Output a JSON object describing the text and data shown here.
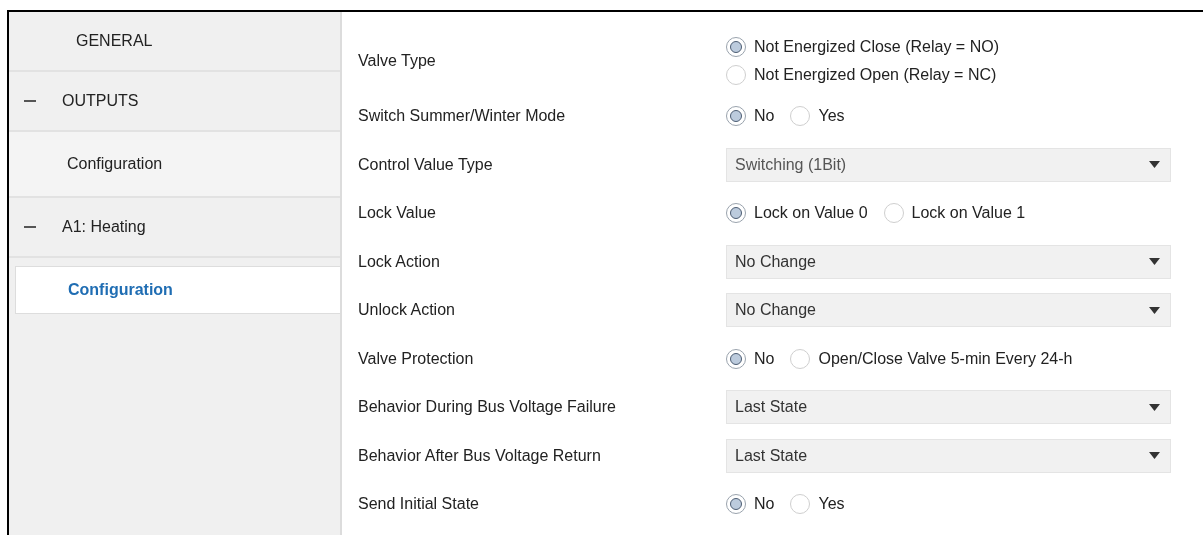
{
  "sidebar": {
    "items": [
      {
        "label": "GENERAL",
        "selected": false
      },
      {
        "label": "OUTPUTS",
        "expanded": true,
        "children": [
          {
            "label": "Configuration",
            "selected": false
          }
        ]
      },
      {
        "label": "A1: Heating",
        "expanded": true,
        "children": [
          {
            "label": "Configuration",
            "selected": true
          }
        ]
      }
    ]
  },
  "parameters": [
    {
      "label": "Valve Type",
      "kind": "radio_column",
      "options": [
        {
          "label": "Not Energized Close (Relay = NO)",
          "selected": true
        },
        {
          "label": "Not Energized Open (Relay = NC)",
          "selected": false
        }
      ]
    },
    {
      "label": "Switch Summer/Winter Mode",
      "kind": "radio",
      "options": [
        {
          "label": "No",
          "selected": true
        },
        {
          "label": "Yes",
          "selected": false
        }
      ]
    },
    {
      "label": "Control Value Type",
      "kind": "dropdown",
      "value": "Switching (1Bit)",
      "disabled": true
    },
    {
      "label": "Lock Value",
      "kind": "radio",
      "options": [
        {
          "label": "Lock on Value 0",
          "selected": true
        },
        {
          "label": "Lock on Value 1",
          "selected": false
        }
      ]
    },
    {
      "label": "Lock Action",
      "kind": "dropdown",
      "value": "No Change",
      "disabled": false
    },
    {
      "label": "Unlock Action",
      "kind": "dropdown",
      "value": "No Change",
      "disabled": false
    },
    {
      "label": "Valve Protection",
      "kind": "radio",
      "options": [
        {
          "label": "No",
          "selected": true
        },
        {
          "label": "Open/Close Valve 5-min Every 24-h",
          "selected": false
        }
      ]
    },
    {
      "label": "Behavior During Bus Voltage Failure",
      "kind": "dropdown",
      "value": "Last State",
      "disabled": false
    },
    {
      "label": "Behavior After Bus Voltage Return",
      "kind": "dropdown",
      "value": "Last State",
      "disabled": false
    },
    {
      "label": "Send Initial State",
      "kind": "radio",
      "options": [
        {
          "label": "No",
          "selected": true
        },
        {
          "label": "Yes",
          "selected": false
        }
      ]
    }
  ]
}
